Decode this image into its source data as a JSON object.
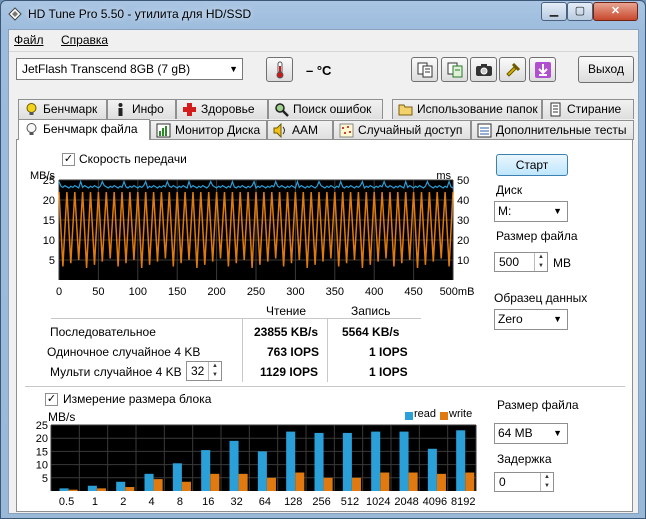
{
  "window": {
    "title": "HD Tune Pro 5.50 - утилита для HD/SSD"
  },
  "menu": [
    "Файл",
    "Справка"
  ],
  "toolbar": {
    "drive": "JetFlash Transcend 8GB (7 gB)",
    "temperature": "– °C",
    "exit_label": "Выход"
  },
  "tabs_row1": [
    "Бенчмарк",
    "Инфо",
    "Здоровье",
    "Поиск ошибок",
    "Использование папок",
    "Стирание"
  ],
  "tabs_row2": [
    "Бенчмарк файла",
    "Монитор Диска",
    "AAM",
    "Случайный доступ",
    "Дополнительные  тесты"
  ],
  "transfer": {
    "checkbox_label": "Скорость передачи",
    "left_unit": "MB/s",
    "right_unit": "ms",
    "y_left_ticks": [
      "25",
      "20",
      "15",
      "10",
      "5"
    ],
    "y_right_ticks": [
      "50",
      "40",
      "30",
      "20",
      "10"
    ],
    "x_ticks": [
      "0",
      "50",
      "100",
      "150",
      "200",
      "250",
      "300",
      "350",
      "400",
      "450",
      "500mB"
    ],
    "read_header": "Чтение",
    "write_header": "Запись",
    "rows": [
      {
        "label": "Последовательное",
        "read": "23855 KB/s",
        "write": "5564 KB/s"
      },
      {
        "label": "Одиночное случайное 4 KB",
        "read": "763 IOPS",
        "write": "1 IOPS"
      },
      {
        "label": "Мульти случайное 4 KB",
        "queue": "32",
        "read": "1129 IOPS",
        "write": "1 IOPS"
      }
    ]
  },
  "right_panel": {
    "start_label": "Старт",
    "disk_label": "Диск",
    "disk_value": "M:",
    "filesize_label": "Размер файла",
    "filesize_value": "500",
    "filesize_unit": "MB",
    "pattern_label": "Образец данных",
    "pattern_value": "Zero"
  },
  "block": {
    "checkbox_label": "Измерение размера блока",
    "unit": "MB/s",
    "legend_read": "read",
    "legend_write": "write",
    "filesize_label": "Размер файла",
    "filesize_value": "64 MB",
    "delay_label": "Задержка",
    "delay_value": "0"
  },
  "colors": {
    "read": "#2b9fd8",
    "write": "#e07a10",
    "chart_bg": "#000000",
    "grid": "#3a3a3a"
  },
  "chart_data": [
    {
      "type": "line",
      "series": [
        {
          "name": "read",
          "y_axis": "MB/s",
          "profile": "constant ~23, spikes to ~25"
        },
        {
          "name": "write",
          "y_axis": "MB/s",
          "profile": "oscillating sawtooth between ~3 and ~22"
        }
      ],
      "x_range": [
        0,
        500
      ],
      "y_left_range": [
        0,
        25
      ],
      "y_right_range": [
        0,
        50
      ],
      "grid": true
    },
    {
      "type": "bar",
      "categories": [
        "0.5",
        "1",
        "2",
        "4",
        "8",
        "16",
        "32",
        "64",
        "128",
        "256",
        "512",
        "1024",
        "2048",
        "4096",
        "8192"
      ],
      "series": [
        {
          "name": "read",
          "values": [
            1,
            2,
            3.5,
            6.5,
            10.5,
            15.5,
            19,
            15,
            22.5,
            22,
            22,
            22.5,
            22.5,
            16,
            23
          ]
        },
        {
          "name": "write",
          "values": [
            0.5,
            1,
            1.5,
            4.5,
            3.5,
            6.5,
            6.5,
            5,
            7,
            5,
            5,
            7,
            7,
            6.5,
            7
          ]
        }
      ],
      "ylim": [
        0,
        25
      ],
      "y_ticks": [
        "25",
        "20",
        "15",
        "10",
        "5"
      ],
      "grid": true,
      "legend": "top-right"
    }
  ]
}
